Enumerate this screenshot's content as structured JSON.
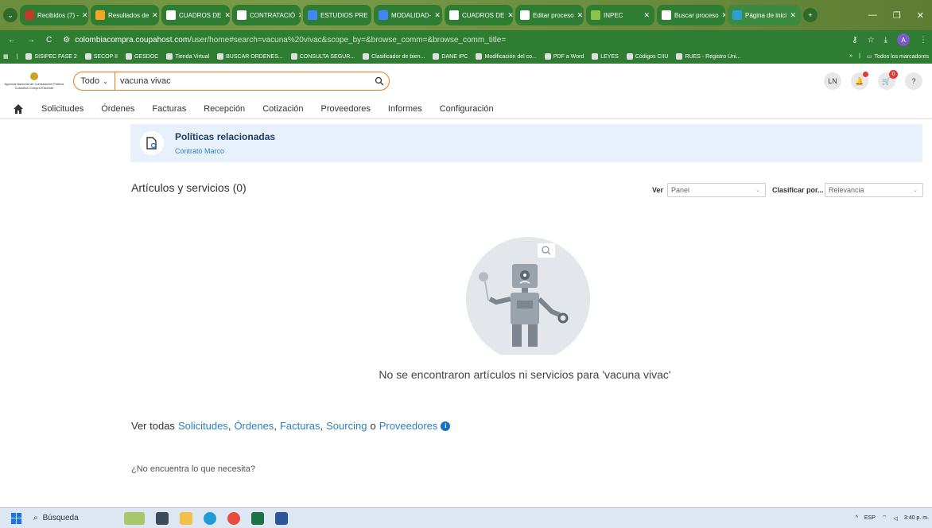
{
  "browser": {
    "tabs": [
      {
        "label": "Recibidos (7) -",
        "icon": "gmail-icon",
        "color": "#c0392b"
      },
      {
        "label": "Resultados de",
        "icon": "web-icon",
        "color": "#f5a623"
      },
      {
        "label": "CUADROS DE",
        "icon": "cross-icon",
        "color": "#ffffff"
      },
      {
        "label": "CONTRATACIÓ",
        "icon": "cross-icon",
        "color": "#ffffff"
      },
      {
        "label": "ESTUDIOS PRE",
        "icon": "docs-icon",
        "color": "#4285f4"
      },
      {
        "label": "MODALIDAD-",
        "icon": "docs-icon",
        "color": "#4285f4"
      },
      {
        "label": "CUADROS DE",
        "icon": "cross-icon",
        "color": "#ffffff"
      },
      {
        "label": "Editar proceso",
        "icon": "page-icon",
        "color": "#ffffff"
      },
      {
        "label": "INPEC",
        "icon": "web-icon",
        "color": "#8bc34a"
      },
      {
        "label": "Buscar proceso",
        "icon": "page-icon",
        "color": "#ffffff"
      },
      {
        "label": "Página de inici",
        "icon": "coupa-icon",
        "color": "#2a9fd6"
      }
    ],
    "url_host": "colombiacompra.coupahost.com",
    "url_path": "/user/home#search=vacuna%20vivac&scope_by=&browse_comm=&browse_comm_title=",
    "profile_initial": "A",
    "bookmarks": [
      "SISIPEC FASE 2",
      "SECOP II",
      "GESDOC",
      "Tienda Virtual",
      "BUSCAR ORDENES...",
      "CONSULTA SEGUR...",
      "Clasificador de bien...",
      "DANE IPC",
      "Modificación del co...",
      "PDF a Word",
      "LEYES",
      "Códigos CIIU",
      "RUES - Registro Úni..."
    ],
    "bookmarks_more": "»",
    "bookmarks_all": "Todos los marcadores"
  },
  "header": {
    "logo_text": "Agencia Nacional de Contratación Pública Colombia Compra Eficiente",
    "scope": "Todo",
    "search_value": "vacuna vivac",
    "user_initials": "LN",
    "cart_count": "0",
    "help": "?"
  },
  "nav": {
    "items": [
      "Solicitudes",
      "Órdenes",
      "Facturas",
      "Recepción",
      "Cotización",
      "Proveedores",
      "Informes",
      "Configuración"
    ]
  },
  "policy": {
    "title": "Políticas relacionadas",
    "link": "Contrato Marco"
  },
  "results": {
    "title": "Artículos y servicios (0)",
    "view_label": "Ver",
    "view_value": "Panel",
    "sort_label": "Clasificar por...",
    "sort_value": "Relevancia",
    "empty_message": "No se encontraron artículos ni servicios para 'vacuna vivac'",
    "see_all_prefix": "Ver todas",
    "links": [
      "Solicitudes",
      "Órdenes",
      "Facturas",
      "Sourcing",
      "Proveedores"
    ],
    "sep1": ",",
    "sep2": ",",
    "sep3": ",",
    "or": "o",
    "not_found": "¿No encuentra lo que necesita?"
  },
  "taskbar": {
    "search": "Búsqueda",
    "lang": "ESP",
    "time": "3:40 p. m."
  },
  "colors": {
    "accent": "#2a7fc4",
    "search_border": "#e67e22",
    "policy_bg": "#e8f1fb"
  }
}
